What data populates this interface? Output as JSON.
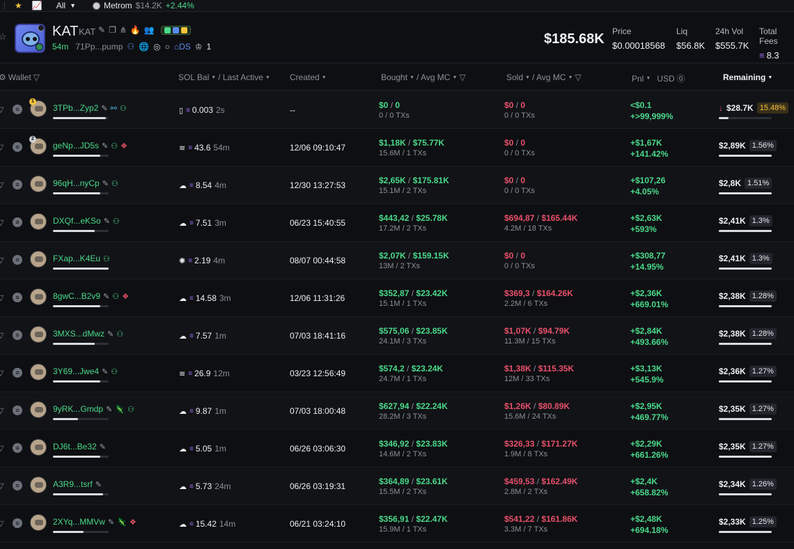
{
  "topbar": {
    "all_label": "All",
    "metrom_name": "Metrom",
    "metrom_mc": "$14.2K",
    "metrom_change": "+2.44%"
  },
  "token": {
    "ticker": "KAT",
    "name": "KAT",
    "age": "54m",
    "address": "71Pp...pump",
    "ds_label": "DS",
    "holders_count": "1",
    "market_cap": "$185.68K",
    "price_label": "Price",
    "price": "$0.00018568",
    "liq_label": "Liq",
    "liq": "$56.8K",
    "vol_label": "24h Vol",
    "vol": "$555.7K",
    "fees_label": "Total Fees",
    "fees": "8.3"
  },
  "columns": {
    "wallet": "Wallet",
    "sol_bal": "SOL Bal",
    "last_active": "/ Last Active",
    "created": "Created",
    "bought": "Bought",
    "avg_mc_buy": "/ Avg MC",
    "sold": "Sold",
    "avg_mc_sell": "/ Avg MC",
    "pnl": "Pnl",
    "usd": "USD",
    "remaining": "Remaining"
  },
  "rows": [
    {
      "rank": "1",
      "wallet": "3TPb...Zyp2",
      "tags": [
        "edit",
        "blue",
        "green"
      ],
      "bar": 0.95,
      "src": "▯",
      "sol": "0.003",
      "age": "2s",
      "created": "--",
      "bought": "$0",
      "bought_mc": "0",
      "bought_sub": "0 / 0 TXs",
      "sold": "$0",
      "sold_mc": "0",
      "sold_sub": "0 / 0 TXs",
      "pnl": "<$0.1",
      "pnl_pct": "+>99,999%",
      "remaining": "$28.7K",
      "rem_pct": "15.48%",
      "rem_bar": 0.18,
      "down": true
    },
    {
      "rank": "2",
      "wallet": "geNp...JD5s",
      "tags": [
        "edit",
        "green",
        "red"
      ],
      "bar": 0.85,
      "src": "≋",
      "sol": "43.6",
      "age": "54m",
      "created": "12/06 09:10:47",
      "bought": "$1,18K",
      "bought_mc": "$75.77K",
      "bought_sub": "15.6M / 1 TXs",
      "sold": "$0",
      "sold_mc": "0",
      "sold_sub": "0 / 0 TXs",
      "pnl": "+$1,67K",
      "pnl_pct": "+141.42%",
      "remaining": "$2,89K",
      "rem_pct": "1.56%",
      "rem_bar": 1.0,
      "down": false
    },
    {
      "rank": "",
      "wallet": "96qH...nyCp",
      "tags": [
        "edit",
        "green"
      ],
      "bar": 0.85,
      "src": "☁",
      "sol": "8.54",
      "age": "4m",
      "created": "12/30 13:27:53",
      "bought": "$2,65K",
      "bought_mc": "$175.81K",
      "bought_sub": "15.1M / 2 TXs",
      "sold": "$0",
      "sold_mc": "0",
      "sold_sub": "0 / 0 TXs",
      "pnl": "+$107,26",
      "pnl_pct": "+4.05%",
      "remaining": "$2,8K",
      "rem_pct": "1.51%",
      "rem_bar": 1.0,
      "down": false
    },
    {
      "rank": "",
      "wallet": "DXQf...eKSo",
      "tags": [
        "edit",
        "green"
      ],
      "bar": 0.75,
      "src": "☁",
      "sol": "7.51",
      "age": "3m",
      "created": "06/23 15:40:55",
      "bought": "$443,42",
      "bought_mc": "$25.78K",
      "bought_sub": "17.2M / 2 TXs",
      "sold": "$694,87",
      "sold_mc": "$165.44K",
      "sold_sub": "4.2M / 18 TXs",
      "pnl": "+$2,63K",
      "pnl_pct": "+593%",
      "remaining": "$2,41K",
      "rem_pct": "1.3%",
      "rem_bar": 1.0,
      "down": false
    },
    {
      "rank": "",
      "wallet": "FXap...K4Eu",
      "tags": [
        "green"
      ],
      "bar": 1.0,
      "src": "✺",
      "sol": "2.19",
      "age": "4m",
      "created": "08/07 00:44:58",
      "bought": "$2,07K",
      "bought_mc": "$159.15K",
      "bought_sub": "13M / 2 TXs",
      "sold": "$0",
      "sold_mc": "0",
      "sold_sub": "0 / 0 TXs",
      "pnl": "+$308,77",
      "pnl_pct": "+14.95%",
      "remaining": "$2,41K",
      "rem_pct": "1.3%",
      "rem_bar": 1.0,
      "down": false
    },
    {
      "rank": "",
      "wallet": "8gwC...B2v9",
      "tags": [
        "edit",
        "green",
        "red"
      ],
      "bar": 0.85,
      "src": "☁",
      "sol": "14.58",
      "age": "3m",
      "created": "12/06 11:31:26",
      "bought": "$352,87",
      "bought_mc": "$23.42K",
      "bought_sub": "15.1M / 1 TXs",
      "sold": "$369,3",
      "sold_mc": "$164.26K",
      "sold_sub": "2.2M / 6 TXs",
      "pnl": "+$2,36K",
      "pnl_pct": "+669.01%",
      "remaining": "$2,38K",
      "rem_pct": "1.28%",
      "rem_bar": 1.0,
      "down": false
    },
    {
      "rank": "",
      "wallet": "3MXS...dMwz",
      "tags": [
        "edit",
        "green"
      ],
      "bar": 0.75,
      "src": "☁",
      "sol": "7.57",
      "age": "1m",
      "created": "07/03 18:41:16",
      "bought": "$575,06",
      "bought_mc": "$23.85K",
      "bought_sub": "24.1M / 3 TXs",
      "sold": "$1,07K",
      "sold_mc": "$94.79K",
      "sold_sub": "11.3M / 15 TXs",
      "pnl": "+$2,84K",
      "pnl_pct": "+493.66%",
      "remaining": "$2,38K",
      "rem_pct": "1.28%",
      "rem_bar": 1.0,
      "down": false
    },
    {
      "rank": "",
      "wallet": "3Y69...Jwe4",
      "tags": [
        "edit",
        "green"
      ],
      "bar": 0.85,
      "src": "≋",
      "sol": "26.9",
      "age": "12m",
      "created": "03/23 12:56:49",
      "bought": "$574,2",
      "bought_mc": "$23.24K",
      "bought_sub": "24.7M / 1 TXs",
      "sold": "$1,38K",
      "sold_mc": "$115.35K",
      "sold_sub": "12M / 33 TXs",
      "pnl": "+$3,13K",
      "pnl_pct": "+545.9%",
      "remaining": "$2,36K",
      "rem_pct": "1.27%",
      "rem_bar": 1.0,
      "down": false
    },
    {
      "rank": "",
      "wallet": "9yRK...Gmdp",
      "tags": [
        "edit",
        "gecko",
        "green"
      ],
      "bar": 0.45,
      "src": "☁",
      "sol": "9.87",
      "age": "1m",
      "created": "07/03 18:00:48",
      "bought": "$627,94",
      "bought_mc": "$22.24K",
      "bought_sub": "28.2M / 3 TXs",
      "sold": "$1,26K",
      "sold_mc": "$80.89K",
      "sold_sub": "15.6M / 24 TXs",
      "pnl": "+$2,95K",
      "pnl_pct": "+469.77%",
      "remaining": "$2,35K",
      "rem_pct": "1.27%",
      "rem_bar": 1.0,
      "down": false
    },
    {
      "rank": "",
      "wallet": "DJ6t...Be32",
      "tags": [
        "edit"
      ],
      "bar": 0.85,
      "src": "☁",
      "sol": "5.05",
      "age": "1m",
      "created": "06/26 03:06:30",
      "bought": "$346,92",
      "bought_mc": "$23.83K",
      "bought_sub": "14.6M / 2 TXs",
      "sold": "$326,33",
      "sold_mc": "$171.27K",
      "sold_sub": "1.9M / 8 TXs",
      "pnl": "+$2,29K",
      "pnl_pct": "+661.26%",
      "remaining": "$2,35K",
      "rem_pct": "1.27%",
      "rem_bar": 1.0,
      "down": false
    },
    {
      "rank": "",
      "wallet": "A3R9...tsrf",
      "tags": [
        "edit"
      ],
      "bar": 0.9,
      "src": "☁",
      "sol": "5.73",
      "age": "24m",
      "created": "06/26 03:19:31",
      "bought": "$364,89",
      "bought_mc": "$23.61K",
      "bought_sub": "15.5M / 2 TXs",
      "sold": "$459,53",
      "sold_mc": "$162.49K",
      "sold_sub": "2.8M / 2 TXs",
      "pnl": "+$2,4K",
      "pnl_pct": "+658.82%",
      "remaining": "$2,34K",
      "rem_pct": "1.26%",
      "rem_bar": 1.0,
      "down": false
    },
    {
      "rank": "",
      "wallet": "2XYq...MMVw",
      "tags": [
        "edit",
        "gecko",
        "red"
      ],
      "bar": 0.55,
      "src": "☁",
      "sol": "15.42",
      "age": "14m",
      "created": "06/21 03:24:10",
      "bought": "$356,91",
      "bought_mc": "$22.47K",
      "bought_sub": "15.9M / 1 TXs",
      "sold": "$541,22",
      "sold_mc": "$161.86K",
      "sold_sub": "3.3M / 7 TXs",
      "pnl": "+$2,48K",
      "pnl_pct": "+694.18%",
      "remaining": "$2,33K",
      "rem_pct": "1.25%",
      "rem_bar": 1.0,
      "down": false
    }
  ]
}
